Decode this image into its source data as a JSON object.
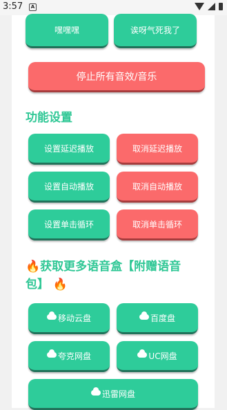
{
  "status": {
    "time": "3:57",
    "notif": "A"
  },
  "top_buttons": [
    "嘿嘿嘿",
    "诶呀气死我了"
  ],
  "stop_all": "停止所有音效/音乐",
  "settings": {
    "heading": "功能设置",
    "set_delay": "设置延迟播放",
    "cancel_delay": "取消延迟播放",
    "set_auto": "设置自动播放",
    "cancel_auto": "取消自动播放",
    "set_loop": "设置单击循环",
    "cancel_loop": "取消单击循环"
  },
  "download": {
    "heading_line1": "获取更多语音盒【附赠语音",
    "heading_line2": "包】",
    "fire_icon": "🔥",
    "buttons": [
      "移动云盘",
      "百度盘",
      "夸克网盘",
      "UC网盘",
      "迅雷网盘"
    ]
  },
  "colors": {
    "green": "#2ecc9a",
    "red": "#fb6a6b",
    "heading": "#2fc795"
  }
}
